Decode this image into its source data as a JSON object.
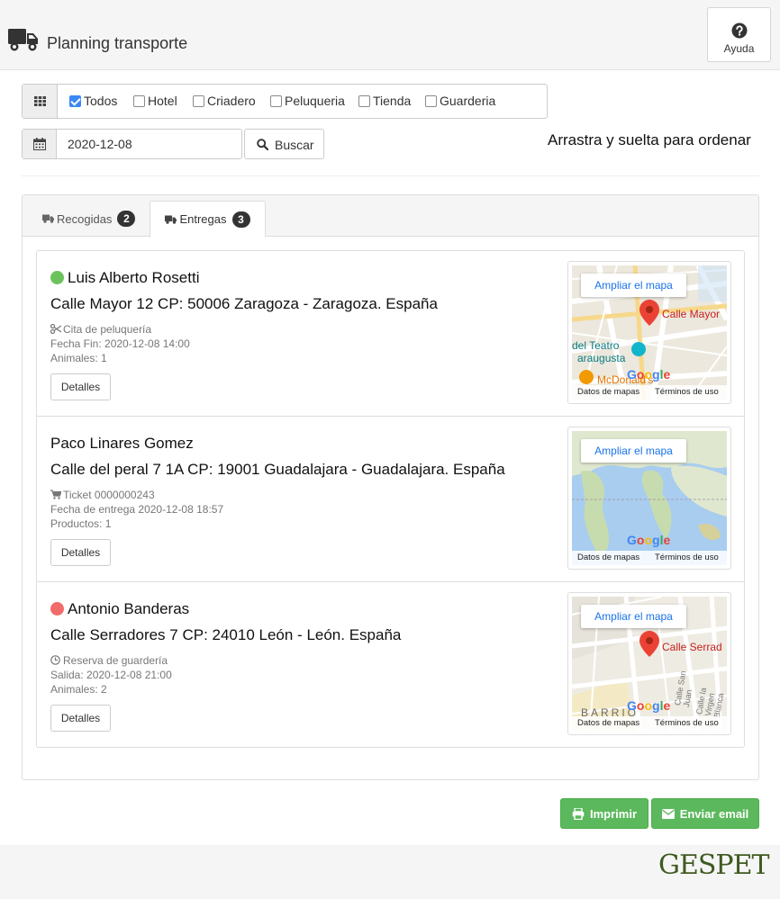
{
  "header": {
    "title": "Planning transporte",
    "help_label": "Ayuda"
  },
  "filters": {
    "options": [
      {
        "label": "Todos",
        "checked": true
      },
      {
        "label": "Hotel",
        "checked": false
      },
      {
        "label": "Criadero",
        "checked": false
      },
      {
        "label": "Peluqueria",
        "checked": false
      },
      {
        "label": "Tienda",
        "checked": false
      },
      {
        "label": "Guarderia",
        "checked": false
      }
    ]
  },
  "search": {
    "date_value": "2020-12-08",
    "button_label": "Buscar",
    "drag_hint": "Arrastra y suelta para ordenar"
  },
  "tabs": [
    {
      "label": "Recogidas",
      "count": "2",
      "active": false
    },
    {
      "label": "Entregas",
      "count": "3",
      "active": true
    }
  ],
  "deliveries": [
    {
      "name": "Luis Alberto Rosetti",
      "status_color": "#6cc35d",
      "address": "Calle Mayor 12 CP: 50006 Zaragoza - Zaragoza. España",
      "service_icon": "scissors-icon",
      "service": "Cita de peluquería",
      "line2": "Fecha Fin: 2020-12-08 14:00",
      "line3": "Animales: 1",
      "details_label": "Detalles",
      "map": {
        "button": "Ampliar el mapa",
        "label": "Calle Mayor",
        "label2": "del Teatro",
        "label3": "araugusta",
        "label4": "McDonald's",
        "footer_left": "Datos de mapas",
        "footer_right": "Términos de uso"
      }
    },
    {
      "name": "Paco Linares Gomez",
      "status_color": "",
      "address": "Calle del peral 7 1A CP: 19001 Guadalajara - Guadalajara. España",
      "service_icon": "cart-icon",
      "service": "Ticket 0000000243",
      "line2": "Fecha de entrega 2020-12-08 18:57",
      "line3": "Productos: 1",
      "details_label": "Detalles",
      "map": {
        "button": "Ampliar el mapa",
        "footer_left": "Datos de mapas",
        "footer_right": "Términos de uso"
      }
    },
    {
      "name": "Antonio Banderas",
      "status_color": "#f26b6b",
      "address": "Calle Serradores 7 CP: 24010 León - León. España",
      "service_icon": "clock-icon",
      "service": "Reserva de guardería",
      "line2": "Salida: 2020-12-08 21:00",
      "line3": "Animales: 2",
      "details_label": "Detalles",
      "map": {
        "button": "Ampliar el mapa",
        "label": "Calle Serrad",
        "label2": "BARRIO",
        "label3": "Calle San Juan",
        "label4": "Calle la Virgen Blanca",
        "footer_left": "Datos de mapas",
        "footer_right": "Términos de uso"
      }
    }
  ],
  "actions": {
    "print_label": "Imprimir",
    "email_label": "Enviar email"
  },
  "brand": {
    "part1": "GES",
    "part2": "PET"
  },
  "colors": {
    "accent_green": "#5cb85c",
    "checkbox_blue": "#3b88f5",
    "brand_green": "#3f5a1f"
  }
}
